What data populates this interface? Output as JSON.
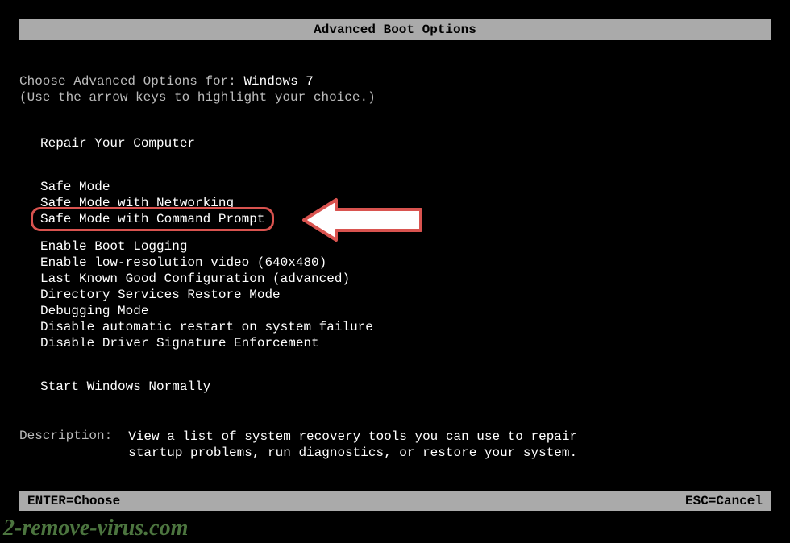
{
  "title": "Advanced Boot Options",
  "prompt": {
    "label": "Choose Advanced Options for: ",
    "os": "Windows 7"
  },
  "hint": "(Use the arrow keys to highlight your choice.)",
  "menu": {
    "repair": "Repair Your Computer",
    "safeMode": "Safe Mode",
    "safeModeNet": "Safe Mode with Networking",
    "safeModeCmd": "Safe Mode with Command Prompt",
    "bootLogging": "Enable Boot Logging",
    "lowRes": "Enable low-resolution video (640x480)",
    "lastKnown": "Last Known Good Configuration (advanced)",
    "dsrm": "Directory Services Restore Mode",
    "debugging": "Debugging Mode",
    "noAutoRestart": "Disable automatic restart on system failure",
    "noDriverSig": "Disable Driver Signature Enforcement",
    "startNormal": "Start Windows Normally"
  },
  "description": {
    "label": "Description:",
    "text": "View a list of system recovery tools you can use to repair startup problems, run diagnostics, or restore your system."
  },
  "footer": {
    "enter": "ENTER=Choose",
    "esc": "ESC=Cancel"
  },
  "watermark": "2-remove-virus.com"
}
